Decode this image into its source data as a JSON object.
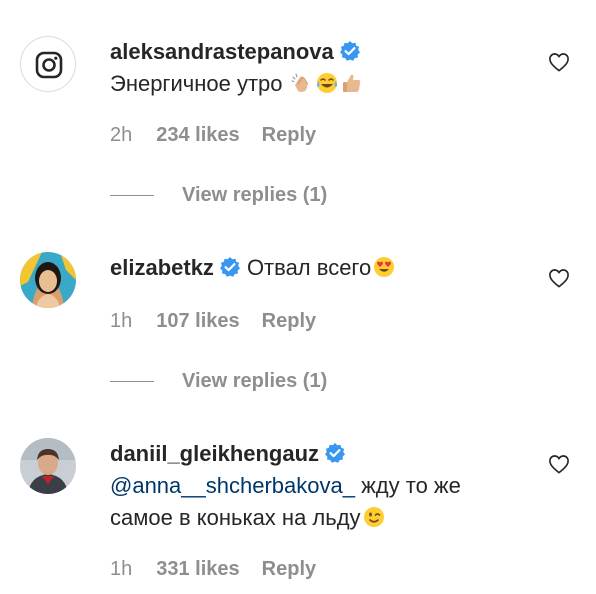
{
  "comments": [
    {
      "username": "aleksandrastepanova",
      "verified": true,
      "avatar_icon": "instagram-logo-icon",
      "text": "Энергичное утро",
      "emojis": [
        "clapping-hands-icon",
        "tears-of-joy-icon",
        "thumbs-up-icon"
      ],
      "time": "2h",
      "likes": "234 likes",
      "reply_label": "Reply",
      "view_replies": "View replies (1)"
    },
    {
      "username": "elizabetkz",
      "verified": true,
      "avatar_icon": "profile-photo-woman",
      "text": "Отвал всего",
      "emojis": [
        "heart-eyes-icon"
      ],
      "time": "1h",
      "likes": "107 likes",
      "reply_label": "Reply",
      "view_replies": "View replies (1)"
    },
    {
      "username": "daniil_gleikhengauz",
      "verified": true,
      "avatar_icon": "profile-photo-man",
      "mention": "@anna__shcherbakova_",
      "text_line1": "жду то же",
      "text_line2": "самое в коньках на льду",
      "emojis": [
        "winking-face-icon"
      ],
      "time": "1h",
      "likes": "331 likes",
      "reply_label": "Reply"
    }
  ],
  "colors": {
    "text": "#262626",
    "secondary": "#8e8e8e",
    "verified": "#3897f0",
    "mention": "#00376b"
  }
}
